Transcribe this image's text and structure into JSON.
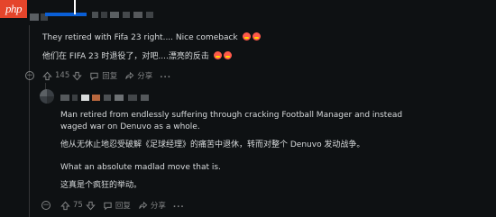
{
  "watermark": {
    "text": "php"
  },
  "comment1": {
    "line_en": "They retired with Fifa 23 right.... Nice comeback",
    "line_zh": "他们在 FIFA 23 时退役了，对吧....漂亮的反击",
    "votes": "145",
    "reply_label": "回复",
    "share_label": "分享",
    "more_label": "..."
  },
  "comment2": {
    "para1_en": "Man retired from endlessly suffering through cracking Football Manager and instead waged war on Denuvo as a whole.",
    "para1_zh": "他从无休止地忍受破解《足球经理》的痛苦中退休，转而对整个 Denuvo 发动战争。",
    "para2_en": "What an absolute madlad move that is.",
    "para2_zh": "这真是个疯狂的举动。",
    "votes": "75",
    "reply_label": "回复",
    "share_label": "分享",
    "more_label": "..."
  },
  "colors": {
    "background": "#0e1113",
    "text": "#d7dadc",
    "muted": "#818384",
    "thread": "#343536",
    "accent_blue": "#0a5fd6"
  },
  "icons": [
    "upvote-icon",
    "downvote-icon",
    "reply-icon",
    "share-icon",
    "more-icon",
    "collapse-icon",
    "emoji-icon"
  ]
}
